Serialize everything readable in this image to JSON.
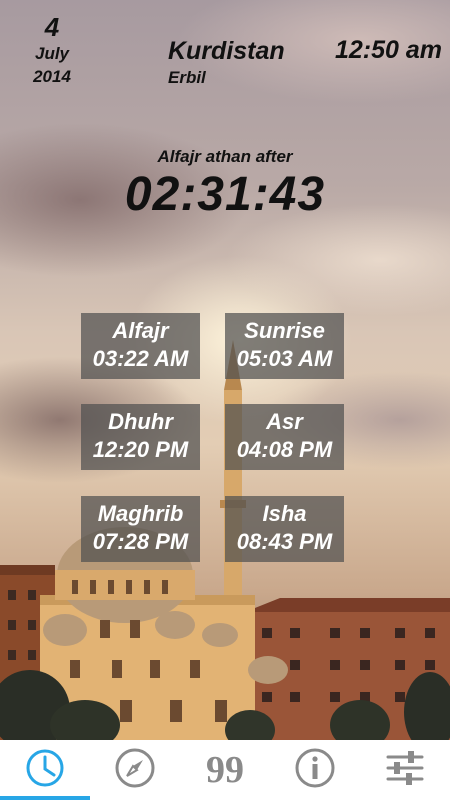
{
  "date": {
    "day": "4",
    "month": "July",
    "year": "2014"
  },
  "location": {
    "country": "Kurdistan",
    "city": "Erbil"
  },
  "clock": "12:50 am",
  "countdown": {
    "label": "Alfajr athan after",
    "value": "02:31:43"
  },
  "prayers": [
    {
      "name": "Alfajr",
      "time": "03:22 AM"
    },
    {
      "name": "Sunrise",
      "time": "05:03 AM"
    },
    {
      "name": "Dhuhr",
      "time": "12:20 PM"
    },
    {
      "name": "Asr",
      "time": "04:08 PM"
    },
    {
      "name": "Maghrib",
      "time": "07:28 PM"
    },
    {
      "name": "Isha",
      "time": "08:43 PM"
    }
  ],
  "tabs": [
    {
      "icon": "clock-icon",
      "active": true
    },
    {
      "icon": "compass-icon",
      "active": false
    },
    {
      "icon": "tasbih-counter-icon",
      "label": "99",
      "active": false
    },
    {
      "icon": "info-icon",
      "active": false
    },
    {
      "icon": "settings-sliders-icon",
      "active": false
    }
  ],
  "colors": {
    "accent": "#27a6e6",
    "tab_icon": "#8a8a8a",
    "card_bg": "rgba(80,80,80,0.72)"
  }
}
